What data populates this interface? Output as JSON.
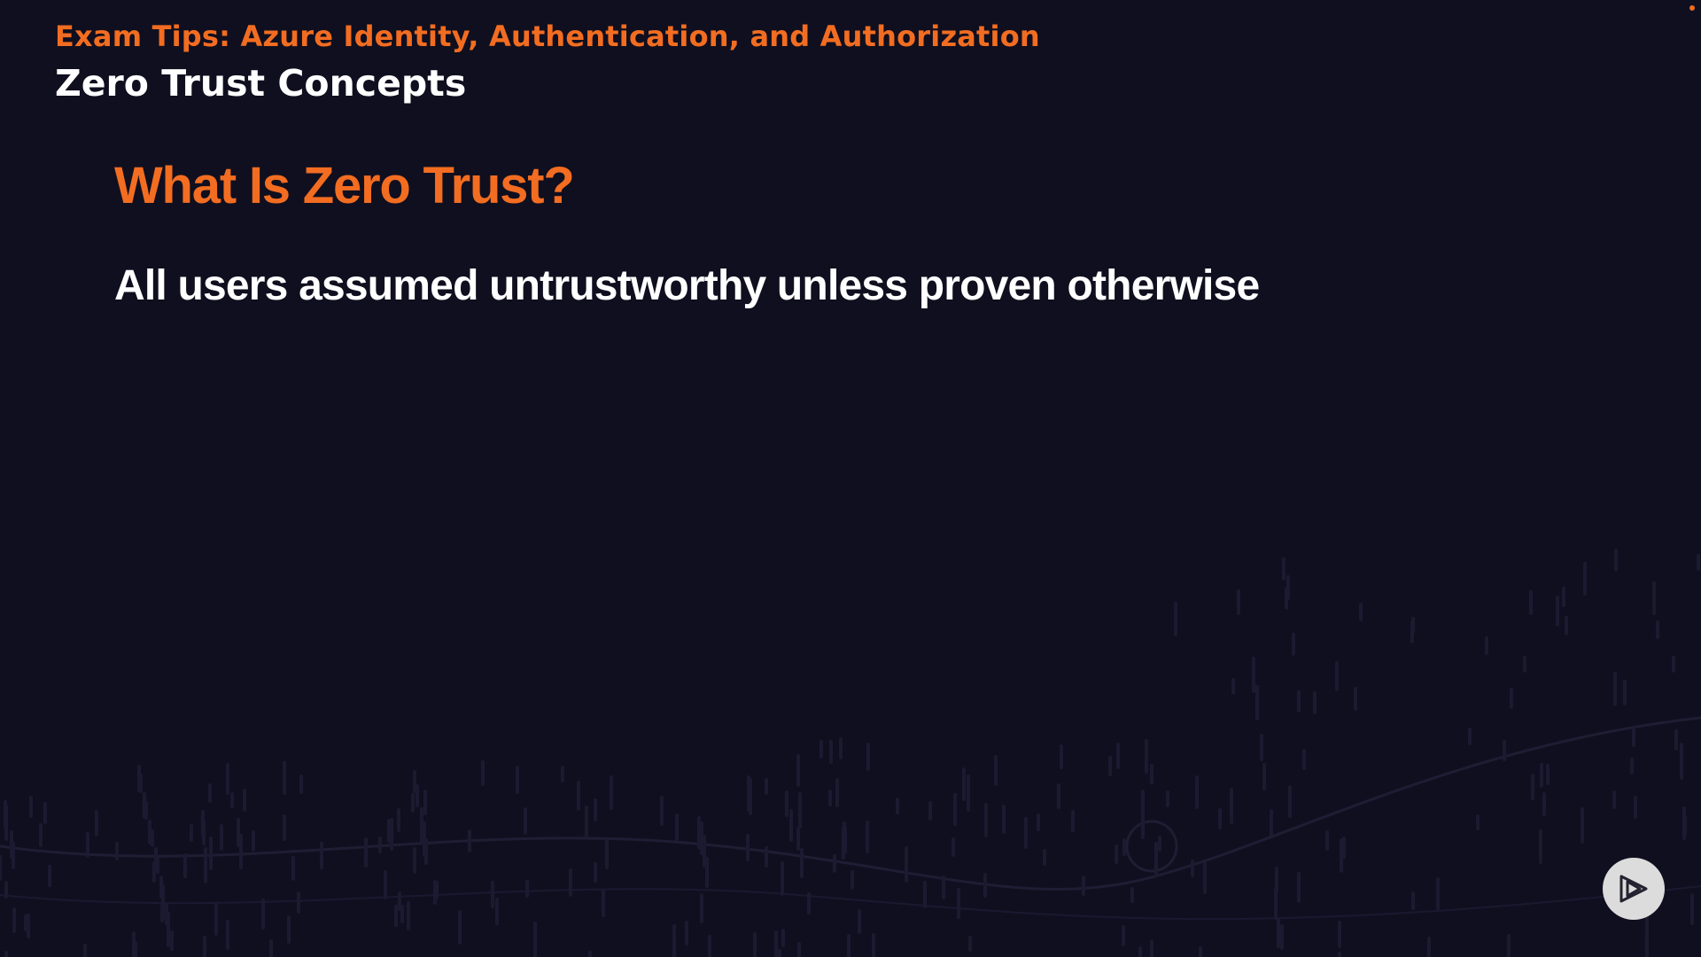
{
  "slide": {
    "course_title": "Exam Tips: Azure Identity, Authentication, and Authorization",
    "module_title": "Zero Trust Concepts",
    "heading": "What Is Zero Trust?",
    "statement": "All users assumed untrustworthy unless proven otherwise"
  },
  "player": {
    "button_icon": "play-logo-icon"
  },
  "colors": {
    "background": "#100f1f",
    "accent": "#f26d21",
    "text": "#ffffff",
    "button": "#dcdcdc"
  }
}
